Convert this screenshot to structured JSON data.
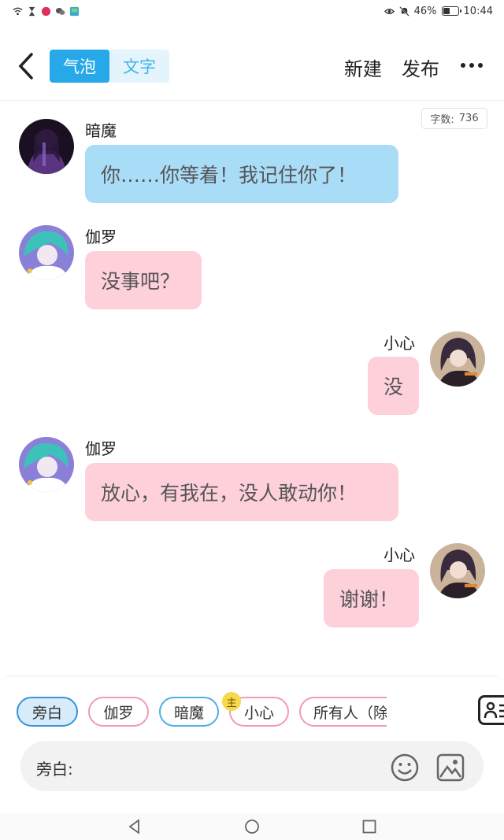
{
  "status_bar": {
    "battery": "46%",
    "time": "10:44",
    "battery_level": 0.46
  },
  "nav": {
    "tabs": [
      {
        "label": "气泡",
        "active": true
      },
      {
        "label": "文字",
        "active": false
      }
    ],
    "new_label": "新建",
    "publish_label": "发布"
  },
  "word_count": {
    "label": "字数:",
    "value": "736"
  },
  "messages": [
    {
      "sender": "暗魔",
      "text": "你……你等着！我记住你了！",
      "side": "left",
      "color": "blue",
      "avatar": "dark-character-avatar"
    },
    {
      "sender": "伽罗",
      "text": "没事吧？",
      "side": "left",
      "color": "pink",
      "avatar": "teal-hair-character-avatar"
    },
    {
      "sender": "小心",
      "text": "没",
      "side": "right",
      "color": "pink",
      "avatar": "purple-hair-character-avatar"
    },
    {
      "sender": "伽罗",
      "text": "放心，有我在，没人敢动你！",
      "side": "left",
      "color": "pink",
      "avatar": "teal-hair-character-avatar"
    },
    {
      "sender": "小心",
      "text": "谢谢！",
      "side": "right",
      "color": "pink",
      "avatar": "purple-hair-character-avatar"
    }
  ],
  "role_chips": [
    {
      "label": "旁白",
      "selected": true
    },
    {
      "label": "伽罗",
      "selected": false
    },
    {
      "label": "暗魔",
      "selected": false
    },
    {
      "label": "小心",
      "selected": false,
      "host": true
    },
    {
      "label": "所有人（除",
      "selected": false
    }
  ],
  "host_badge": "主",
  "input": {
    "label": "旁白:"
  },
  "colors": {
    "accent": "#27a9e9",
    "bubble_blue": "#a9dcf7",
    "bubble_pink": "#fdd0da",
    "chip_pink_border": "#f19bb1"
  }
}
